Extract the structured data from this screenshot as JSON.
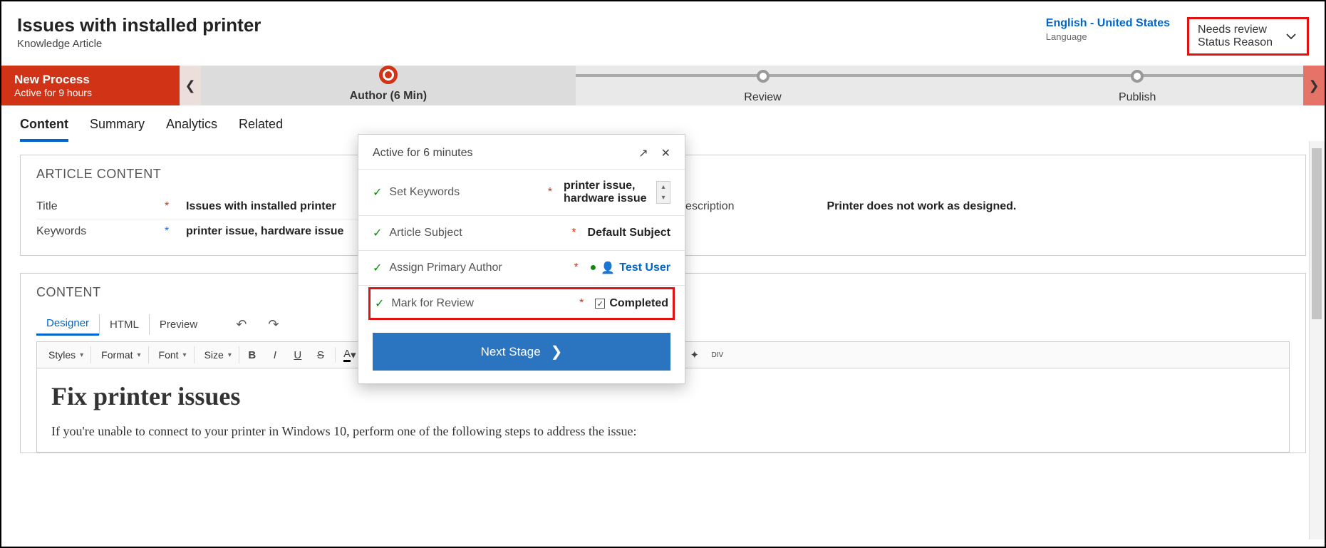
{
  "header": {
    "title": "Issues with installed printer",
    "subtitle": "Knowledge Article",
    "language": {
      "value": "English - United States",
      "label": "Language"
    },
    "status": {
      "value": "Needs review",
      "label": "Status Reason"
    }
  },
  "process": {
    "name": "New Process",
    "duration": "Active for 9 hours",
    "stages": [
      {
        "label": "Author  (6 Min)",
        "active": true
      },
      {
        "label": "Review",
        "active": false
      },
      {
        "label": "Publish",
        "active": false
      }
    ]
  },
  "tabs": [
    {
      "label": "Content",
      "active": true
    },
    {
      "label": "Summary",
      "active": false
    },
    {
      "label": "Analytics",
      "active": false
    },
    {
      "label": "Related",
      "active": false
    }
  ],
  "article": {
    "section_title": "ARTICLE CONTENT",
    "title_label": "Title",
    "title_value": "Issues with installed printer",
    "keywords_label": "Keywords",
    "keywords_value": "printer issue, hardware issue",
    "description_label": "Description",
    "description_value": "Printer does not work as designed."
  },
  "content": {
    "section_title": "CONTENT",
    "tabs": [
      {
        "label": "Designer",
        "active": true
      },
      {
        "label": "HTML",
        "active": false
      },
      {
        "label": "Preview",
        "active": false
      }
    ],
    "toolbar": {
      "styles": "Styles",
      "format": "Format",
      "font": "Font",
      "size": "Size"
    },
    "body": {
      "heading": "Fix printer issues",
      "paragraph": "If you're unable to connect to your printer in Windows 10, perform one of the following steps to address the issue:"
    }
  },
  "flyout": {
    "header": "Active for 6 minutes",
    "rows": [
      {
        "label": "Set Keywords",
        "value": "printer issue, hardware issue",
        "type": "text-scroll"
      },
      {
        "label": "Article Subject",
        "value": "Default Subject",
        "type": "text"
      },
      {
        "label": "Assign Primary Author",
        "value": "Test User",
        "type": "person"
      },
      {
        "label": "Mark for Review",
        "value": "Completed",
        "type": "checkbox",
        "highlight": true
      }
    ],
    "button": "Next Stage"
  }
}
